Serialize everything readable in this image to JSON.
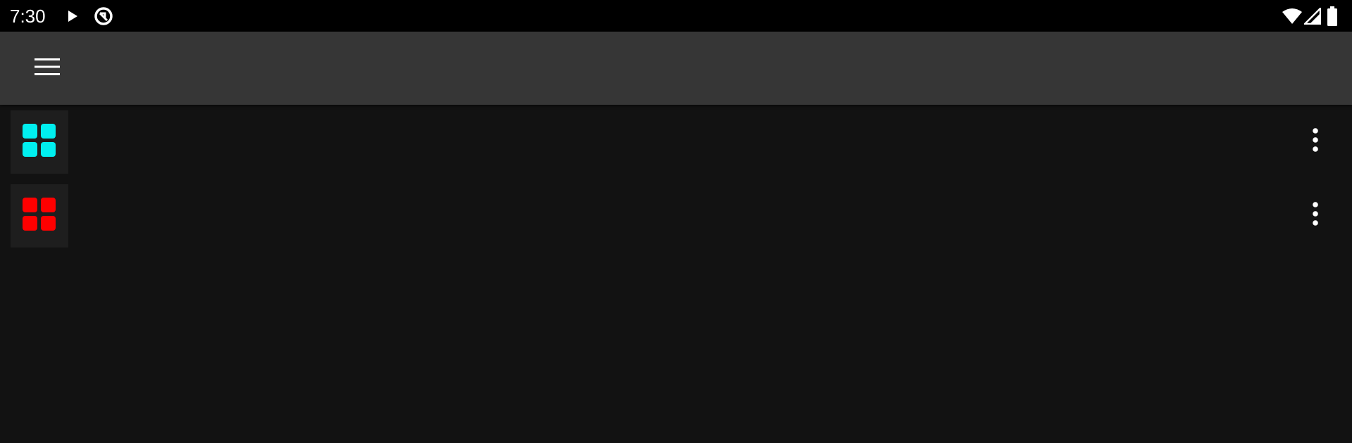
{
  "status_bar": {
    "time": "7:30",
    "icons": [
      "play-icon",
      "data-saver-icon",
      "wifi-icon",
      "signal-icon",
      "battery-icon"
    ]
  },
  "app_bar": {
    "menu_icon": "hamburger-menu-icon"
  },
  "list": {
    "items": [
      {
        "title": "",
        "icon": "grid-tiles-icon",
        "color": "#00f0f0",
        "overflow_icon": "more-vertical-icon"
      },
      {
        "title": "",
        "icon": "grid-tiles-icon",
        "color": "#ff0000",
        "overflow_icon": "more-vertical-icon"
      }
    ]
  },
  "colors": {
    "background": "#121212",
    "app_bar": "#363636",
    "status_bar": "#000000",
    "tile_background": "#1e1e1e"
  }
}
